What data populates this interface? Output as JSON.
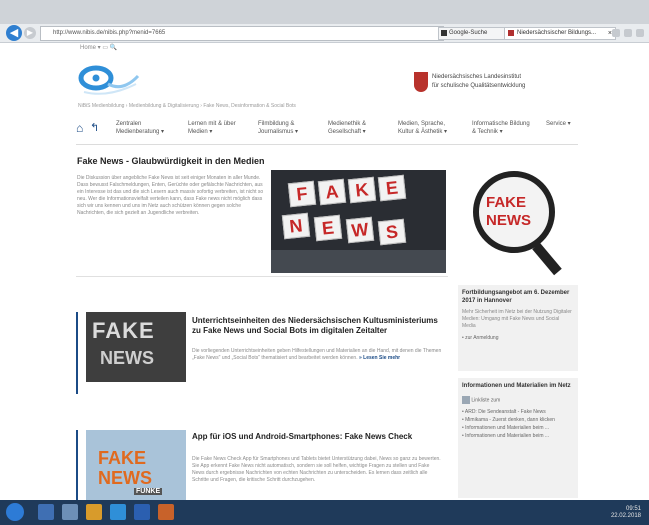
{
  "browser": {
    "address": "http://www.nibis.de/nibis.php?menid=7665",
    "tab_small": "Google-Suche",
    "tab_main": "Niedersächsischer Bildungs...",
    "tab_close": "×"
  },
  "site": {
    "util_links": "Home ▾   ▭   🔍",
    "ministry_line1": "Niedersächsisches Landesinstitut",
    "ministry_line2": "für schulische Qualitätsentwicklung",
    "breadcrumb": "NiBiS Medienbildung  ›  Medienbildung & Digitalisierung  ›  Fake News, Desinformation & Social Bots",
    "nav": [
      {
        "label": "Zentralen Medienberatung ▾"
      },
      {
        "label": "Lernen mit & über Medien ▾"
      },
      {
        "label": "Filmbildung & Journalismus ▾"
      },
      {
        "label": "Medienethik & Gesellschaft ▾"
      },
      {
        "label": "Medien, Sprache, Kultur & Ästhetik ▾"
      },
      {
        "label": "Informatische Bildung & Technik ▾"
      },
      {
        "label": "Service ▾"
      }
    ]
  },
  "featured": {
    "title": "Fake News - Glaubwürdigkeit in den Medien",
    "text": "Die Diskussion über angebliche Fake News ist seit einiger Monaten in aller Munde. Dass bewusst Falschmeldungen, Enten, Gerüchte oder gefälschte Nachrichten, aus ein Interesse ist das und die sich Lesern auch massiv sofortig verbreiten, ist nicht so neu. Wer die Informationsvielfalt verteilen kann, dass Fake news nicht möglich dass sich wir uns kennen und uns im Netz auch schützen können gegen solche Nachrichten, die sich gezielt an Jugendliche verbreiten.",
    "keys": [
      "F",
      "A",
      "K",
      "E",
      "N",
      "E",
      "W",
      "S"
    ]
  },
  "articles": [
    {
      "title": "Unterrichtseinheiten des Niedersächsischen Kultusministeriums zu Fake News und Social Bots im digitalen Zeitalter",
      "text": "Die vorliegenden Unterrichtseinheiten geben Hilfestellungen und Materialien an die Hand, mit denen die Themen „Fake News\" und „Social Bots\" thematisiert und bearbeitet werden können.",
      "more": "» Lesen Sie mehr",
      "img_text": [
        "FAKE",
        "NEWS"
      ]
    },
    {
      "title": "App für iOS und Android-Smartphones: Fake News Check",
      "text": "Die Fake News Check App für Smartphones und Tablets bietet Unterstützung dabei, News so ganz zu bewerten. Sie App erkennt Fake News nicht automatisch, sondern sie soll helfen, wichtige Fragen zu stellen und Fake News durch ergebnisse Nachrichten von echten Nachrichten zu unterscheiden. Es lernen dass zeitlich alle Schritte und Fragen, die kritische Schritt durchzugehen.",
      "img_text": [
        "FAKE",
        "NEWS",
        "FUNKE"
      ]
    }
  ],
  "sidebar": {
    "img_text": [
      "FAKE",
      "NEWS"
    ],
    "box1_title": "Fortbildungsangebot am 6. Dezember 2017 in Hannover",
    "box1_text": "Mehr Sicherheit im Netz bei der Nutzung Digitaler Medien: Umgang mit Fake News und Social Media",
    "box1_bullet": "zur Anmeldung",
    "box2_title": "Informationen und Materialien im Netz",
    "box2_link": "Linkliste zum",
    "box2_bullets": [
      "ARD: Die Sendeanstalt - Fake News",
      "Mimikama - Zuerst denken, dann klicken",
      "Informationen und Materialien beim ...",
      "Informationen und Materialien beim ..."
    ]
  },
  "taskbar": {
    "time": "09:51",
    "date": "22.02.2018"
  },
  "colors": {
    "accent": "#1b4b86",
    "ministry_red": "#b8322c",
    "fake_red": "#c62828"
  }
}
